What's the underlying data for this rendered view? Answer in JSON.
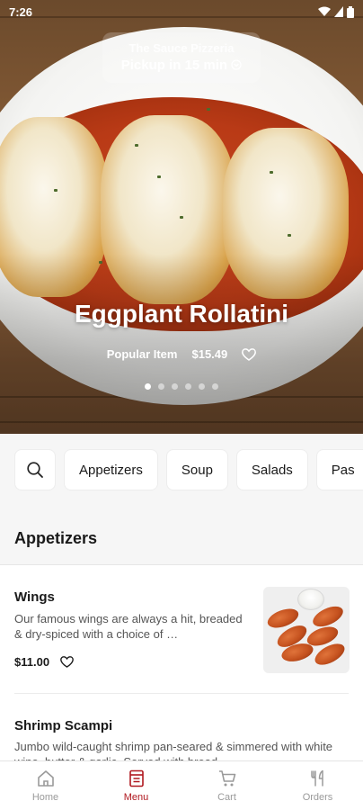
{
  "status_bar": {
    "time": "7:26"
  },
  "hero": {
    "store_name": "The Sauce Pizzeria",
    "pickup_text": "Pickup in 15 min",
    "featured_title": "Eggplant Rollatini",
    "badge": "Popular Item",
    "price": "$15.49",
    "carousel_count": 6,
    "carousel_active": 0
  },
  "categories": {
    "search_icon": "search-icon",
    "items": [
      "Appetizers",
      "Soup",
      "Salads",
      "Pas"
    ]
  },
  "section": {
    "title": "Appetizers"
  },
  "menu_items": [
    {
      "name": "Wings",
      "description": "Our famous wings are always a hit, breaded & dry-spiced with a choice of …",
      "price": "$11.00"
    },
    {
      "name": "Shrimp Scampi",
      "description": "Jumbo wild-caught shrimp pan-seared & simmered with white wine, butter & garlic. Served with bread."
    }
  ],
  "bottom_nav": [
    {
      "label": "Home",
      "icon": "home-icon",
      "active": false
    },
    {
      "label": "Menu",
      "icon": "menu-icon",
      "active": true
    },
    {
      "label": "Cart",
      "icon": "cart-icon",
      "active": false
    },
    {
      "label": "Orders",
      "icon": "orders-icon",
      "active": false
    }
  ],
  "colors": {
    "accent": "#b0181f",
    "chip_bg": "#f6f6f6"
  }
}
